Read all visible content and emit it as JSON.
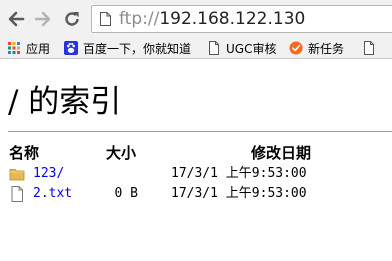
{
  "browser": {
    "url_scheme": "ftp://",
    "url_host": "192.168.122.130"
  },
  "bookmarks": {
    "items": [
      {
        "label": "应用",
        "icon": "apps-grid-icon"
      },
      {
        "label": "百度一下，你就知道",
        "icon": "baidu-paw-icon"
      },
      {
        "label": "UGC审核",
        "icon": "page-icon"
      },
      {
        "label": "新任务",
        "icon": "new-task-icon"
      }
    ]
  },
  "page": {
    "title": "/ 的索引",
    "columns": {
      "name": "名称",
      "size": "大小",
      "date": "修改日期"
    },
    "entries": [
      {
        "name": "123/",
        "size": "",
        "date": "17/3/1 上午9:53:00",
        "type": "folder"
      },
      {
        "name": "2.txt",
        "size": "0 B",
        "date": "17/3/1 上午9:53:00",
        "type": "file"
      }
    ]
  },
  "colors": {
    "link": "#0000ee",
    "folder": "#e8b94a",
    "chrome_bg": "#f1f1f1",
    "divider": "#9a9a9a"
  }
}
